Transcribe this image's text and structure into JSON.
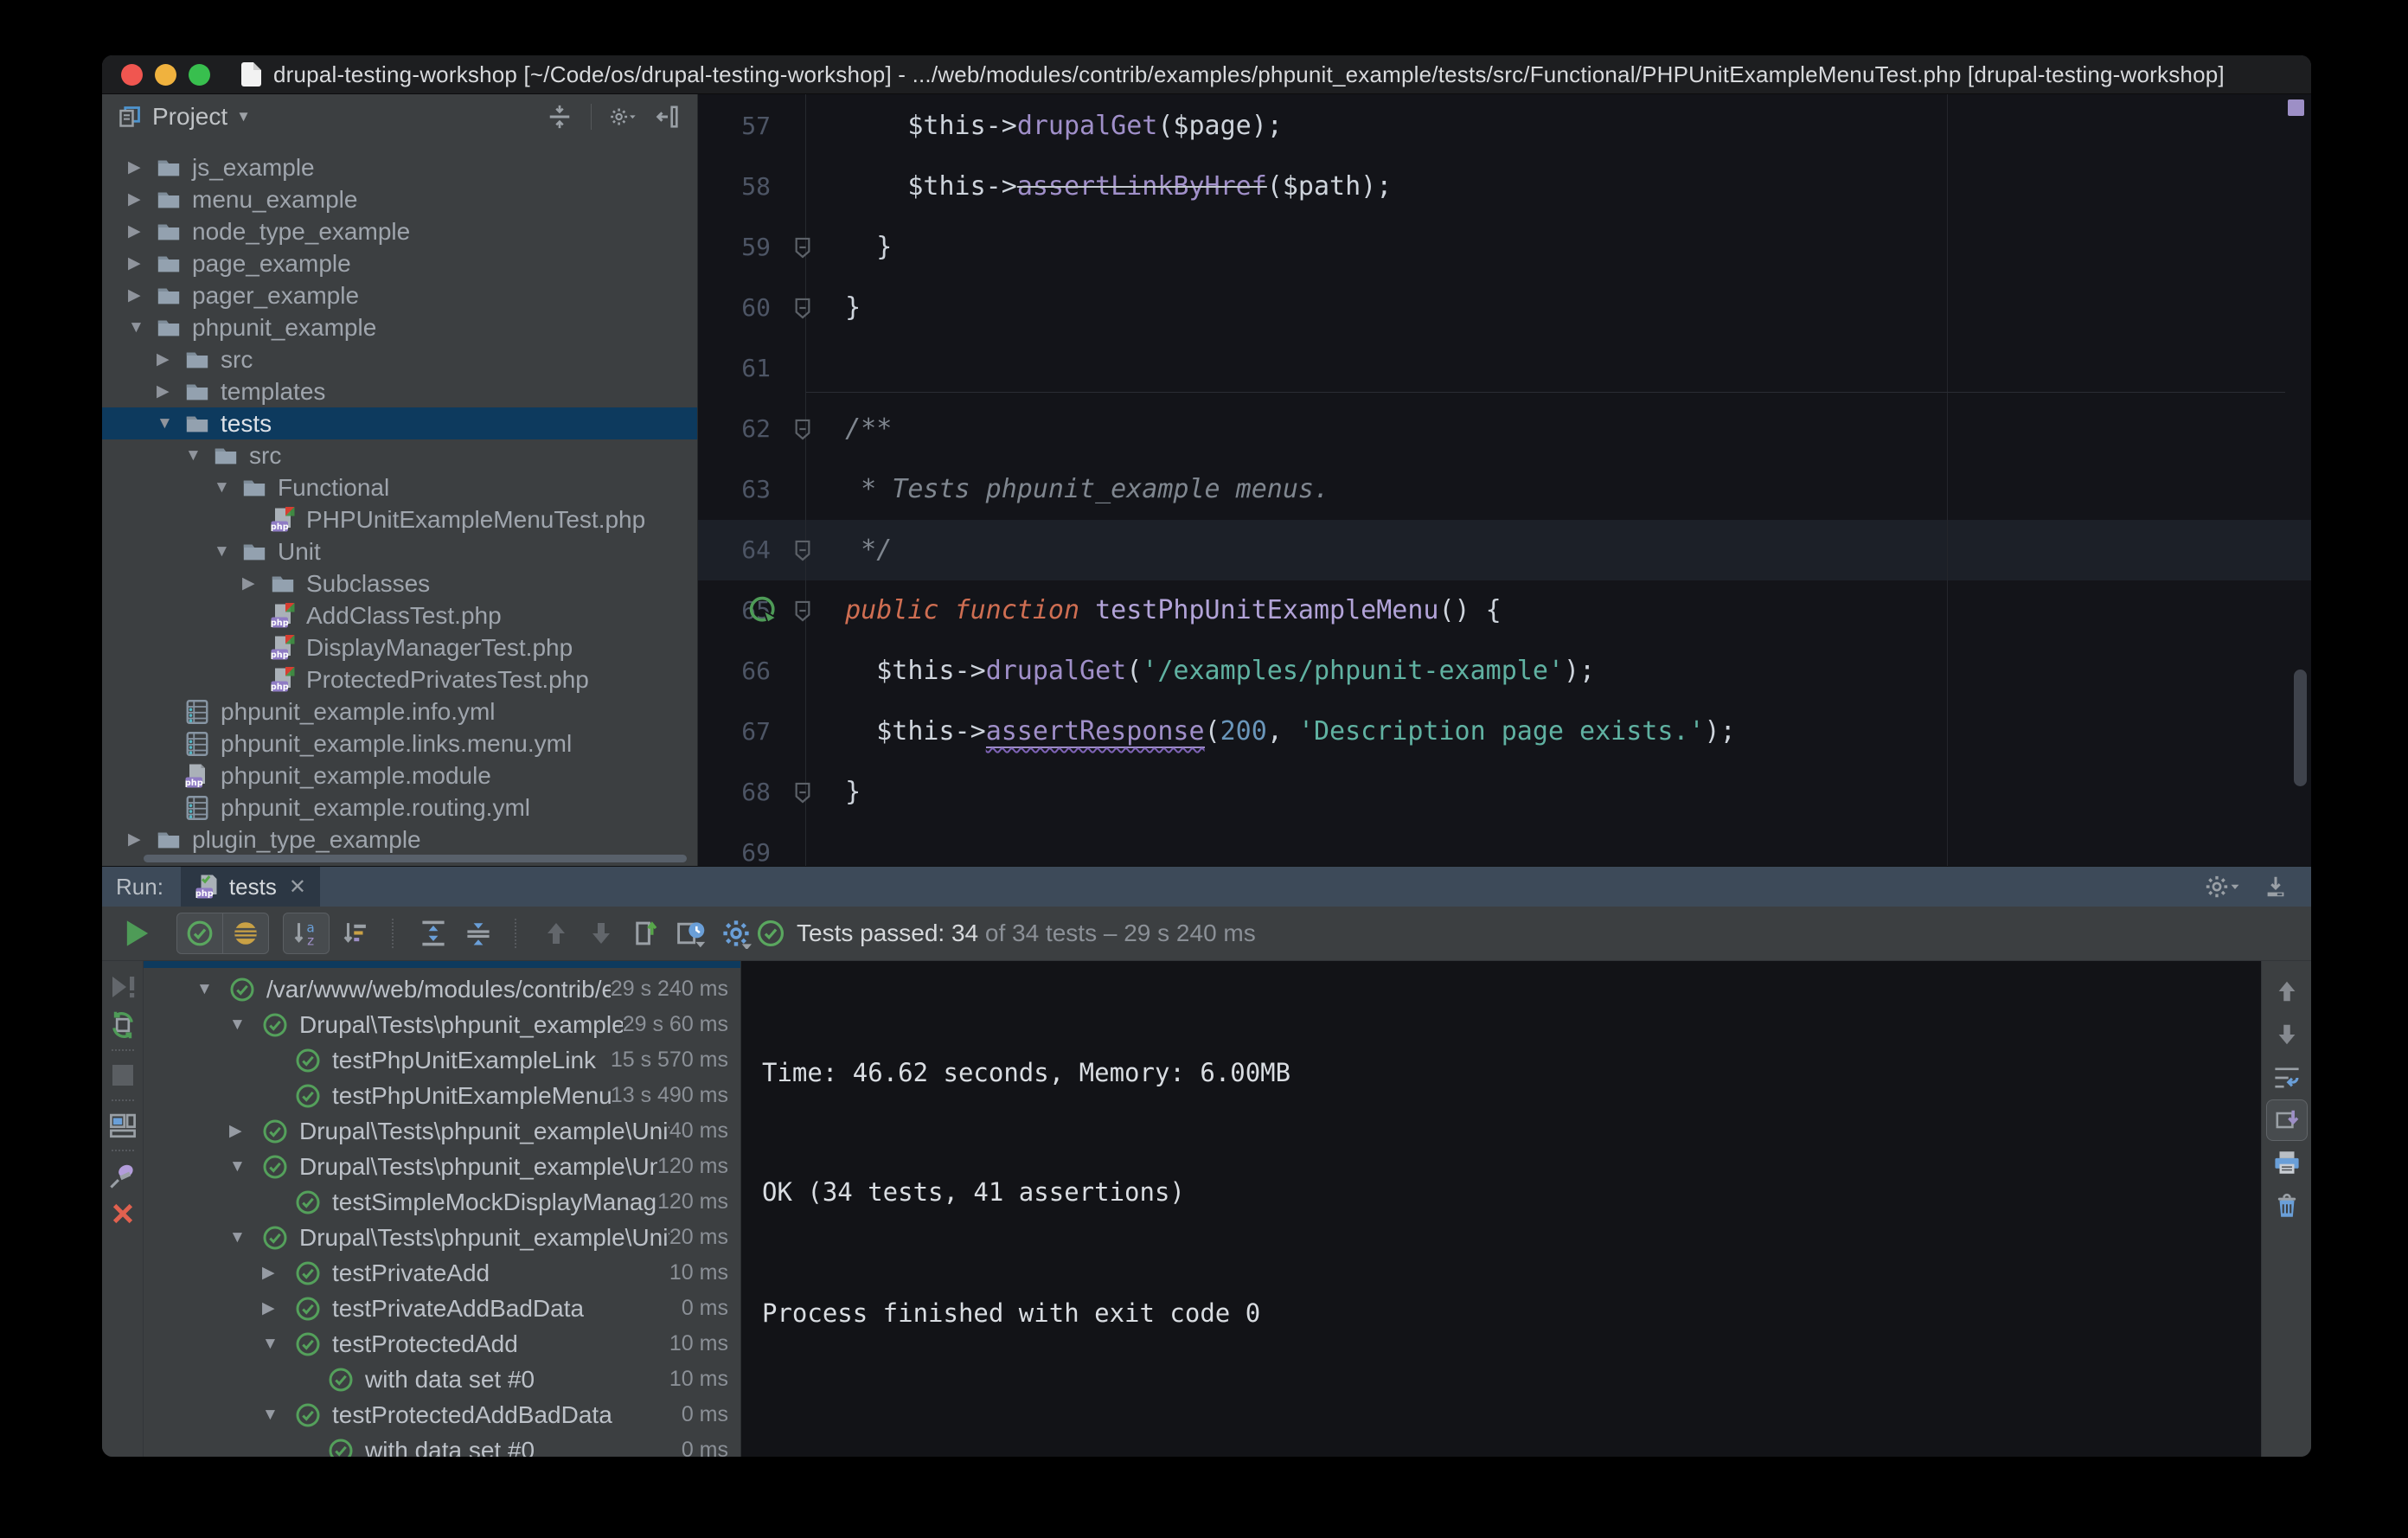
{
  "window": {
    "title": "drupal-testing-workshop [~/Code/os/drupal-testing-workshop] - .../web/modules/contrib/examples/phpunit_example/tests/src/Functional/PHPUnitExampleMenuTest.php [drupal-testing-workshop]"
  },
  "colors": {
    "accent_green": "#4e9b57",
    "accent_blue": "#6a9fd8",
    "accent_purple": "#9d8fc6",
    "accent_amber": "#c9a145",
    "accent_red": "#db5c5c",
    "selection_blue": "#0d3a5e",
    "string_green": "#60b2a2",
    "keyword_orange": "#cf6e52",
    "method_lavender": "#a08fc9"
  },
  "project": {
    "title": "Project",
    "tree": [
      {
        "label": "js_example",
        "depth": 0,
        "arrow": "closed",
        "icon": "folder"
      },
      {
        "label": "menu_example",
        "depth": 0,
        "arrow": "closed",
        "icon": "folder"
      },
      {
        "label": "node_type_example",
        "depth": 0,
        "arrow": "closed",
        "icon": "folder"
      },
      {
        "label": "page_example",
        "depth": 0,
        "arrow": "closed",
        "icon": "folder"
      },
      {
        "label": "pager_example",
        "depth": 0,
        "arrow": "closed",
        "icon": "folder"
      },
      {
        "label": "phpunit_example",
        "depth": 0,
        "arrow": "open",
        "icon": "folder"
      },
      {
        "label": "src",
        "depth": 1,
        "arrow": "closed",
        "icon": "folder"
      },
      {
        "label": "templates",
        "depth": 1,
        "arrow": "closed",
        "icon": "folder"
      },
      {
        "label": "tests",
        "depth": 1,
        "arrow": "open",
        "icon": "folder",
        "selected": true
      },
      {
        "label": "src",
        "depth": 2,
        "arrow": "open",
        "icon": "folder"
      },
      {
        "label": "Functional",
        "depth": 3,
        "arrow": "open",
        "icon": "folder"
      },
      {
        "label": "PHPUnitExampleMenuTest.php",
        "depth": 4,
        "arrow": "none",
        "icon": "phpt"
      },
      {
        "label": "Unit",
        "depth": 3,
        "arrow": "open",
        "icon": "folder"
      },
      {
        "label": "Subclasses",
        "depth": 4,
        "arrow": "closed",
        "icon": "folder"
      },
      {
        "label": "AddClassTest.php",
        "depth": 4,
        "arrow": "none",
        "icon": "phpt"
      },
      {
        "label": "DisplayManagerTest.php",
        "depth": 4,
        "arrow": "none",
        "icon": "phpt"
      },
      {
        "label": "ProtectedPrivatesTest.php",
        "depth": 4,
        "arrow": "none",
        "icon": "phpt"
      },
      {
        "label": "phpunit_example.info.yml",
        "depth": 1,
        "arrow": "none",
        "icon": "yml"
      },
      {
        "label": "phpunit_example.links.menu.yml",
        "depth": 1,
        "arrow": "none",
        "icon": "yml"
      },
      {
        "label": "phpunit_example.module",
        "depth": 1,
        "arrow": "none",
        "icon": "phpm"
      },
      {
        "label": "phpunit_example.routing.yml",
        "depth": 1,
        "arrow": "none",
        "icon": "yml"
      },
      {
        "label": "plugin_type_example",
        "depth": 0,
        "arrow": "closed",
        "icon": "folder"
      }
    ]
  },
  "editor": {
    "lines": [
      {
        "n": 57,
        "tokens": [
          [
            "      $this->",
            "p"
          ],
          [
            "drupalGet",
            "m"
          ],
          [
            "($page);",
            "p"
          ]
        ]
      },
      {
        "n": 58,
        "tokens": [
          [
            "      $this->",
            "p"
          ],
          [
            "assertLinkByHref",
            "dep"
          ],
          [
            "($path);",
            "p"
          ]
        ]
      },
      {
        "n": 59,
        "tokens": [
          [
            "    }",
            "p"
          ]
        ],
        "fold": true
      },
      {
        "n": 60,
        "tokens": [
          [
            "  }",
            "p"
          ]
        ],
        "fold": true
      },
      {
        "n": 61,
        "tokens": []
      },
      {
        "n": 62,
        "tokens": [
          [
            "  /**",
            "c"
          ]
        ],
        "fold": true,
        "sep": true
      },
      {
        "n": 63,
        "tokens": [
          [
            "   * Tests phpunit_example menus.",
            "c"
          ]
        ]
      },
      {
        "n": 64,
        "tokens": [
          [
            "   */",
            "c"
          ]
        ],
        "fold": true,
        "hl": true
      },
      {
        "n": 65,
        "tokens": [
          [
            "  ",
            "p"
          ],
          [
            "public",
            "k"
          ],
          [
            " ",
            "p"
          ],
          [
            "function",
            "k"
          ],
          [
            " ",
            "p"
          ],
          [
            "testPhpUnitExampleMenu",
            "d"
          ],
          [
            "() {",
            "p"
          ]
        ],
        "fold": true,
        "run": true
      },
      {
        "n": 66,
        "tokens": [
          [
            "    $this->",
            "p"
          ],
          [
            "drupalGet",
            "m"
          ],
          [
            "(",
            "p"
          ],
          [
            "'/examples/phpunit-example'",
            "s"
          ],
          [
            ");",
            "p"
          ]
        ]
      },
      {
        "n": 67,
        "tokens": [
          [
            "    $this->",
            "p"
          ],
          [
            "assertResponse",
            "warn"
          ],
          [
            "(",
            "p"
          ],
          [
            "200",
            "n"
          ],
          [
            ", ",
            "p"
          ],
          [
            "'Description page exists.'",
            "s"
          ],
          [
            ");",
            "p"
          ]
        ]
      },
      {
        "n": 68,
        "tokens": [
          [
            "  }",
            "p"
          ]
        ],
        "fold": true
      },
      {
        "n": 69,
        "tokens": []
      }
    ]
  },
  "run": {
    "label": "Run:",
    "tab": "tests",
    "status_strong": "Tests passed: 34",
    "status_rest": " of 34 tests – 29 s 240 ms",
    "tree": [
      {
        "label": "/var/www/web/modules/contrib/exa",
        "duration": "29 s 240 ms",
        "depth": 0,
        "arrow": "open"
      },
      {
        "label": "Drupal\\Tests\\phpunit_example\\Fu",
        "duration": "29 s 60 ms",
        "depth": 1,
        "arrow": "open"
      },
      {
        "label": "testPhpUnitExampleLink",
        "duration": "15 s 570 ms",
        "depth": 2,
        "arrow": "none"
      },
      {
        "label": "testPhpUnitExampleMenu",
        "duration": "13 s 490 ms",
        "depth": 2,
        "arrow": "none"
      },
      {
        "label": "Drupal\\Tests\\phpunit_example\\Unit\\A",
        "duration": "40 ms",
        "depth": 1,
        "arrow": "closed"
      },
      {
        "label": "Drupal\\Tests\\phpunit_example\\Unit\\I",
        "duration": "120 ms",
        "depth": 1,
        "arrow": "open"
      },
      {
        "label": "testSimpleMockDisplayManager",
        "duration": "120 ms",
        "depth": 2,
        "arrow": "none"
      },
      {
        "label": "Drupal\\Tests\\phpunit_example\\Unit\\P",
        "duration": "20 ms",
        "depth": 1,
        "arrow": "open"
      },
      {
        "label": "testPrivateAdd",
        "duration": "10 ms",
        "depth": 2,
        "arrow": "closed"
      },
      {
        "label": "testPrivateAddBadData",
        "duration": "0 ms",
        "depth": 2,
        "arrow": "closed"
      },
      {
        "label": "testProtectedAdd",
        "duration": "10 ms",
        "depth": 2,
        "arrow": "open"
      },
      {
        "label": "with data set #0",
        "duration": "10 ms",
        "depth": 3,
        "arrow": "none"
      },
      {
        "label": "testProtectedAddBadData",
        "duration": "0 ms",
        "depth": 2,
        "arrow": "open"
      },
      {
        "label": "with data set #0",
        "duration": "0 ms",
        "depth": 3,
        "arrow": "none"
      }
    ],
    "console": [
      "Time: 46.62 seconds, Memory: 6.00MB",
      "OK (34 tests, 41 assertions)",
      "Process finished with exit code 0"
    ]
  }
}
